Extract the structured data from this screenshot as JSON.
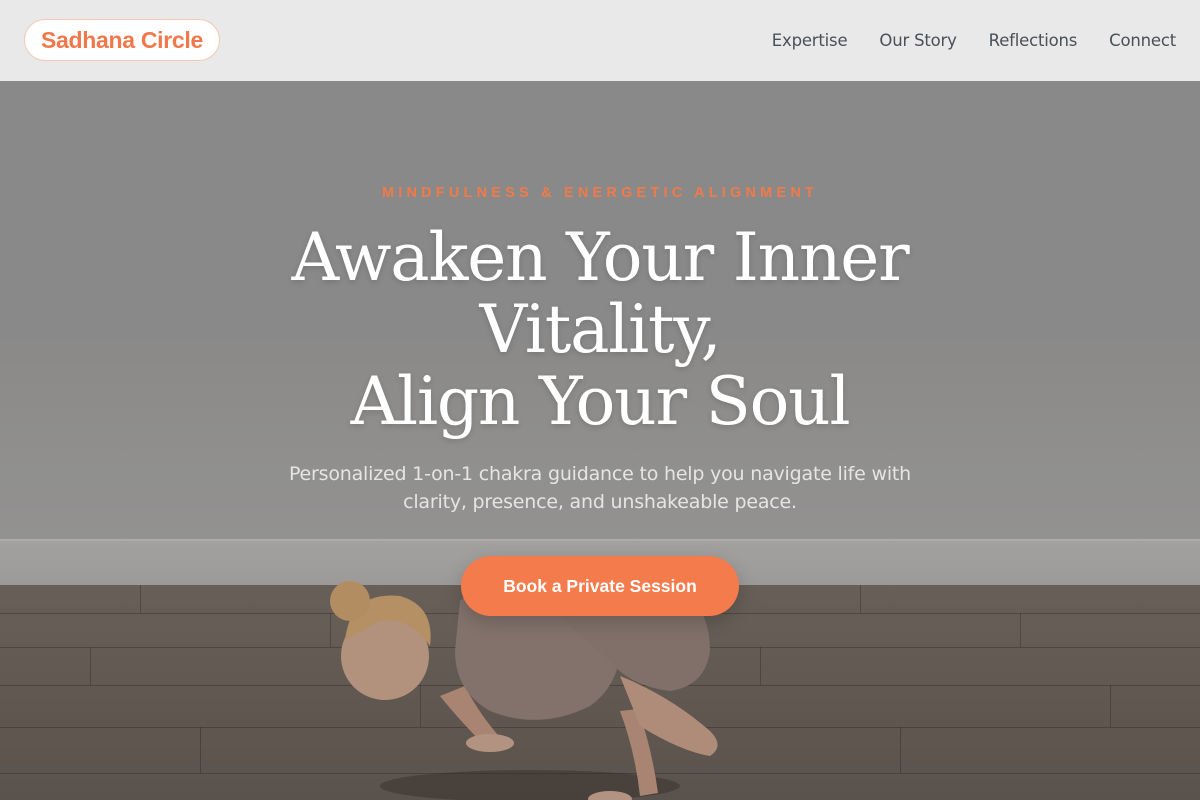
{
  "brand": {
    "name": "Sadhana Circle",
    "accent_color": "#f47c4c"
  },
  "nav": {
    "items": [
      {
        "label": "Expertise"
      },
      {
        "label": "Our Story"
      },
      {
        "label": "Reflections"
      },
      {
        "label": "Connect"
      }
    ]
  },
  "hero": {
    "eyebrow": "MINDFULNESS & ENERGETIC ALIGNMENT",
    "headline_lines": [
      "Awaken Your Inner",
      "Vitality,",
      "Align Your Soul"
    ],
    "subtext": "Personalized 1-on-1 chakra guidance to help you navigate life with clarity, presence, and unshakeable peace.",
    "cta_label": "Book a Private Session",
    "background_image": "yoga-practitioner-arm-balance-pose"
  }
}
